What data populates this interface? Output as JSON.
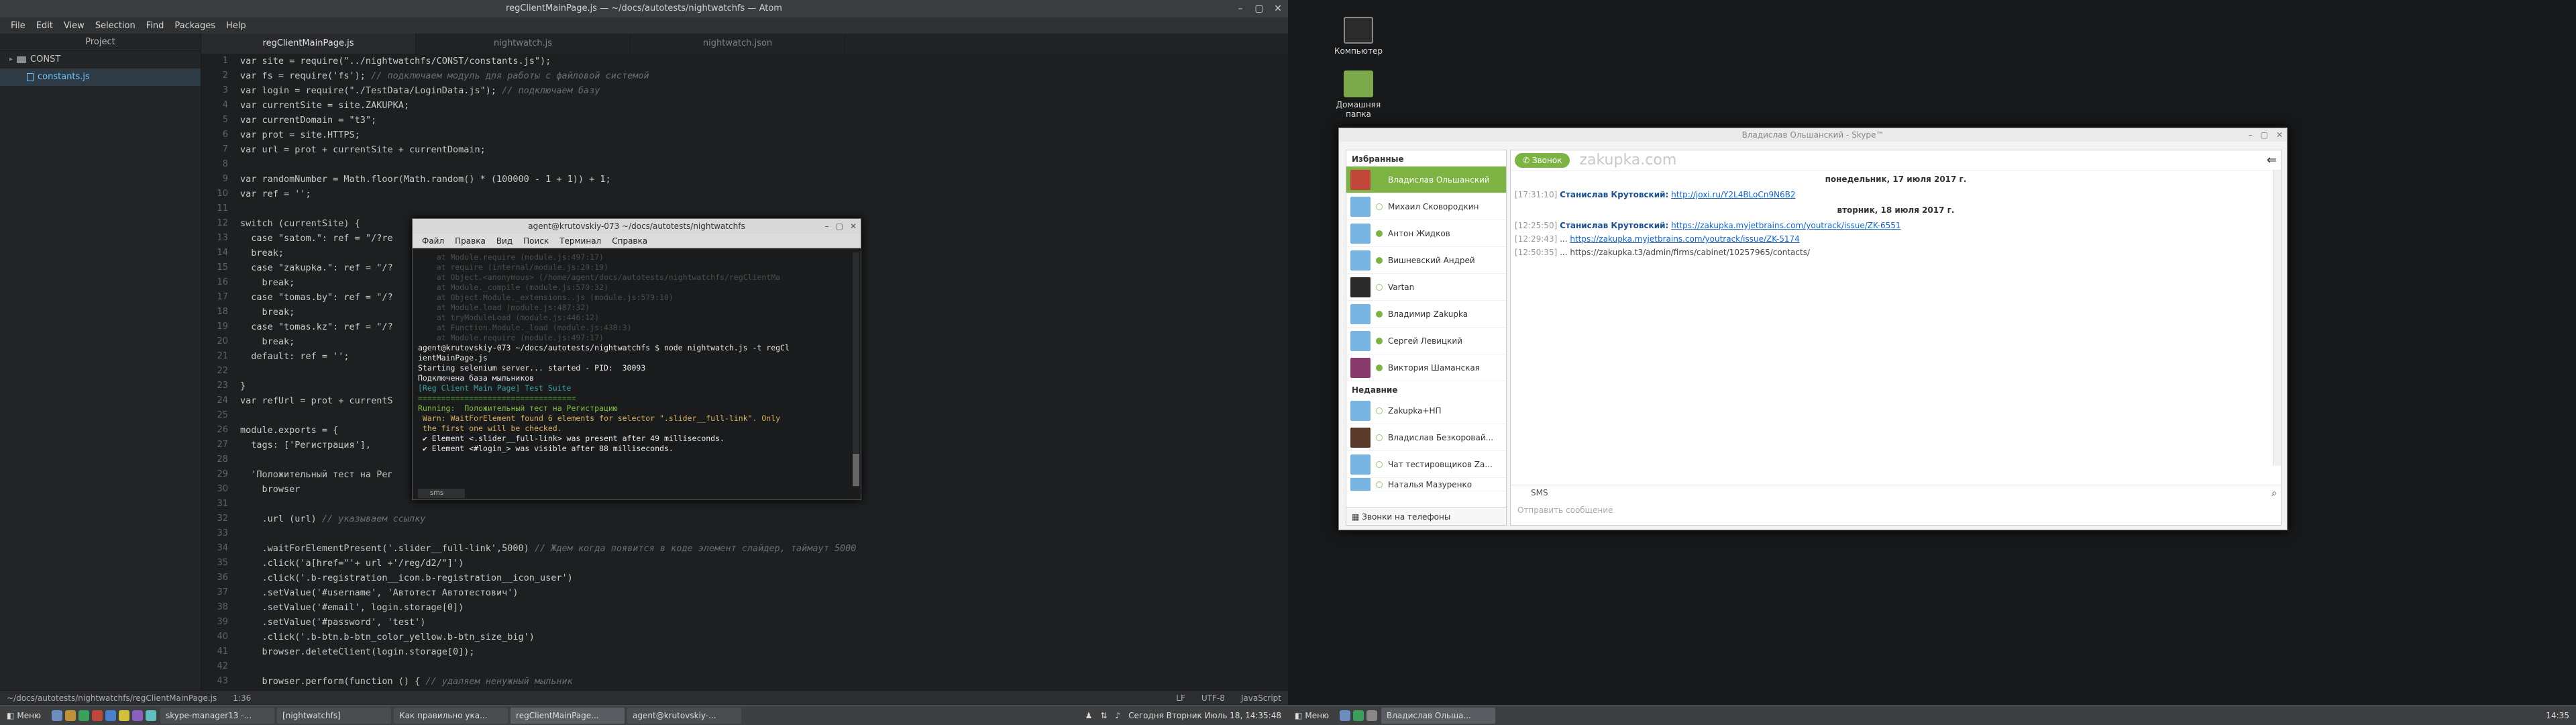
{
  "atom": {
    "title": "regClientMainPage.js — ~/docs/autotests/nightwatchfs — Atom",
    "menu": [
      "File",
      "Edit",
      "View",
      "Selection",
      "Find",
      "Packages",
      "Help"
    ],
    "tree_header": "Project",
    "tree": [
      {
        "label": "CONST",
        "type": "folder"
      },
      {
        "label": "constants.js",
        "type": "file"
      }
    ],
    "tabs": [
      "regClientMainPage.js",
      "nightwatch.js",
      "nightwatch.json"
    ],
    "status": {
      "path": "~/docs/autotests/nightwatchfs/regClientMainPage.js",
      "pos": "1:36",
      "eol": "LF",
      "enc": "UTF-8",
      "grammar": "JavaScript"
    }
  },
  "code_lines": [
    "var site = require(\"../nightwatchfs/CONST/constants.js\");",
    "var fs = require('fs'); // подключаем модуль для работы с файловой системой",
    "var login = require(\"./TestData/LoginData.js\"); // подключаем базу",
    "var currentSite = site.ZAKUPKA;",
    "var currentDomain = \"t3\";",
    "var prot = site.HTTPS;",
    "var url = prot + currentSite + currentDomain;",
    "",
    "var randomNumber = Math.floor(Math.random() * (100000 - 1 + 1)) + 1;",
    "var ref = '';",
    "",
    "switch (currentSite) {",
    "  case \"satom.\": ref = \"/?re",
    "  break;",
    "  case \"zakupka.\": ref = \"/?",
    "    break;",
    "  case \"tomas.by\": ref = \"/?",
    "    break;",
    "  case \"tomas.kz\": ref = \"/?",
    "    break;",
    "  default: ref = '';",
    "",
    "}",
    "var refUrl = prot + currentS",
    "",
    "module.exports = {",
    "  tags: ['Регистрация'],",
    "",
    "  'Положительный тест на Рег",
    "    browser",
    "",
    "    .url (url) // указываем ссылку",
    "",
    "    .waitForElementPresent('.slider__full-link',5000) // Ждем когда появится в коде элемент слайдер, таймаут 5000",
    "    .click('a[href=\"'+ url +'/reg/d2/\"]')",
    "    .click('.b-registration__icon.b-registration__icon_user')",
    "    .setValue('#username', 'Автотест Автотестович')",
    "    .setValue('#email', login.storage[0])",
    "    .setValue('#password', 'test')",
    "    .click('.b-btn.b-btn_color_yellow.b-btn_size_big')",
    "    browser.deleteClient(login.storage[0]);",
    "",
    "    browser.perform(function () { // удаляем ненужный мыльник"
  ],
  "terminal": {
    "title": "agent@krutovskiy-073 ~/docs/autotests/nightwatchfs",
    "menu": [
      "Файл",
      "Правка",
      "Вид",
      "Поиск",
      "Терминал",
      "Справка"
    ],
    "lines": [
      {
        "t": "    at Module.require (module.js:497:17)",
        "c": "dim"
      },
      {
        "t": "    at require (internal/module.js:20:19)",
        "c": "dim"
      },
      {
        "t": "    at Object.<anonymous> (/home/agent/docs/autotests/nightwatchfs/regClientMa",
        "c": "dim"
      },
      {
        "t": "    at Module._compile (module.js:570:32)",
        "c": "dim"
      },
      {
        "t": "    at Object.Module._extensions..js (module.js:579:10)",
        "c": "dim"
      },
      {
        "t": "    at Module.load (module.js:487:32)",
        "c": "dim"
      },
      {
        "t": "    at tryModuleLoad (module.js:446:12)",
        "c": "dim"
      },
      {
        "t": "    at Function.Module._load (module.js:438:3)",
        "c": "dim"
      },
      {
        "t": "    at Module.require (module.js:497:17)",
        "c": "dim"
      },
      {
        "t": "",
        "c": "dim"
      },
      {
        "t": "agent@krutovskiy-073 ~/docs/autotests/nightwatchfs $ node nightwatch.js -t regCl",
        "c": "white"
      },
      {
        "t": "ientMainPage.js",
        "c": "white"
      },
      {
        "t": "Starting selenium server... started - PID:  30093",
        "c": "white"
      },
      {
        "t": "Подключена база мыльников",
        "c": "white"
      },
      {
        "t": "",
        "c": "white"
      },
      {
        "t": "[Reg Client Main Page] Test Suite",
        "c": "cyan"
      },
      {
        "t": "==================================",
        "c": "grn2"
      },
      {
        "t": "",
        "c": "white"
      },
      {
        "t": "Running:  Положительный тест на Регистрацию",
        "c": "green"
      },
      {
        "t": " Warn: WaitForElement found 6 elements for selector \".slider__full-link\". Only",
        "c": "yel"
      },
      {
        "t": " the first one will be checked.",
        "c": "yel"
      },
      {
        "t": " ✔ Element <.slider__full-link> was present after 49 milliseconds.",
        "c": "white"
      },
      {
        "t": " ✔ Element <#login_> was visible after 88 milliseconds.",
        "c": "white"
      }
    ],
    "tab": "sms"
  },
  "taskbar_left": {
    "menu": "Меню",
    "tasks": [
      "skype-manager13 -...",
      "[nightwatchfs]",
      "Как правильно ука...",
      "regClientMainPage...",
      "agent@krutovskiy-..."
    ],
    "clock": "Сегодня Вторник Июль 18, 14:35:48"
  },
  "desktop_icons": [
    "Компьютер",
    "Домашняя папка"
  ],
  "skype": {
    "title": "Владислав Ольшанский - Skype™",
    "favorites_label": "Избранные",
    "favorites": [
      "Владислав Ольшанский",
      "Михаил Сковородкин",
      "Антон Жидков",
      "Вишневский Андрей",
      "Vartan",
      "Владимир Zakupka",
      "Сергей Левицкий",
      "Виктория Шаманская"
    ],
    "recent_label": "Недавние",
    "recent": [
      "Zakupka+НП",
      "Владислав Безкоровай...",
      "Чат тестировщиков Za...",
      "Наталья Мазуренко"
    ],
    "phones": "Звонки на телефоны",
    "call_button": "Звонок",
    "logo": "zakupka.com",
    "date1": "понедельник, 17 июля 2017 г.",
    "date2": "вторник, 18 июля 2017 г.",
    "messages": [
      {
        "time": "[17:31:10]",
        "name": "Станислав Крутовский:",
        "link": "http://joxi.ru/Y2L4BLoCn9N6B2"
      },
      {
        "time": "[12:25:50]",
        "name": "Станислав Крутовский:",
        "link": "https://zakupka.myjetbrains.com/youtrack/issue/ZK-6551"
      },
      {
        "time": "[12:29:43]",
        "name": "...",
        "link": "https://zakupka.myjetbrains.com/youtrack/issue/ZK-5174"
      },
      {
        "time": "[12:50:35]",
        "name": "...",
        "plain": "https://zakupka.t3/admin/firms/cabinet/10257965/contacts/"
      }
    ],
    "input_mode": "SMS",
    "input_placeholder": "Отправить сообщение"
  },
  "taskbar_right": {
    "menu": "Меню",
    "tasks": [
      "Владислав Ольша..."
    ],
    "clock": "14:35"
  }
}
